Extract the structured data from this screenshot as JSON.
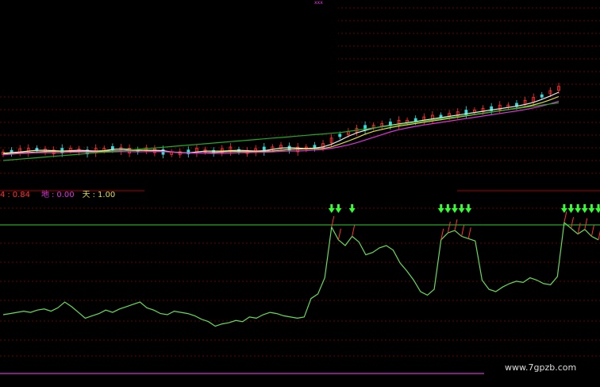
{
  "top_tag": "xxx",
  "indicator_readout": {
    "value_a_label": "4",
    "value_a": "0.84",
    "value_b_label": "地",
    "value_b": "0.00",
    "value_c_label": "天",
    "value_c": "1.00",
    "sep": ":"
  },
  "watermark": "www.7gpzb.com",
  "colors": {
    "background": "#000000",
    "grid_red": "#8a0000",
    "oscillator": "#66dd55",
    "level_line": "#33cc33",
    "ma_long": "#22aa22",
    "ma_white": "#e8e8e8",
    "ma_yellow": "#dddd44",
    "ma_magenta": "#dd33dd",
    "candle_up": "#ff3333",
    "candle_down": "#33dddd",
    "signal_arrow": "#33ff33",
    "pane_divider": "#aa0000",
    "base_line_magenta": "#cc33cc"
  },
  "chart_data": [
    {
      "type": "line",
      "title": "",
      "series": [
        {
          "values": [
            10,
            11,
            12,
            12,
            13,
            12,
            11,
            12,
            13,
            12,
            11,
            12,
            13,
            14,
            13,
            12,
            12,
            13,
            12,
            11,
            10,
            10,
            11,
            12,
            12,
            11,
            12,
            13,
            12,
            11,
            12,
            13,
            14,
            15,
            14,
            13,
            14,
            15,
            16,
            20,
            24,
            26,
            28,
            30,
            31,
            32,
            33,
            34,
            35,
            36,
            37,
            38,
            39,
            40,
            41,
            42,
            43,
            44,
            45,
            46,
            47,
            48,
            50,
            52,
            55,
            58,
            61
          ]
        }
      ]
    },
    {
      "type": "line",
      "title": "",
      "series": [
        {
          "values": [
            20,
            21,
            22,
            23,
            22,
            24,
            25,
            23,
            26,
            31,
            27,
            22,
            17,
            19,
            21,
            24,
            22,
            25,
            27,
            29,
            31,
            26,
            24,
            21,
            20,
            23,
            22,
            21,
            19,
            16,
            14,
            10,
            12,
            13,
            15,
            14,
            18,
            17,
            20,
            22,
            21,
            19,
            18,
            17,
            18,
            34,
            38,
            52,
            96,
            85,
            80,
            88,
            83,
            72,
            74,
            78,
            80,
            76,
            65,
            58,
            50,
            40,
            37,
            42,
            85,
            91,
            93,
            88,
            86,
            84,
            50,
            42,
            40,
            44,
            47,
            49,
            48,
            52,
            50,
            47,
            46,
            53,
            100,
            95,
            90,
            94,
            88,
            85
          ]
        }
      ]
    }
  ]
}
